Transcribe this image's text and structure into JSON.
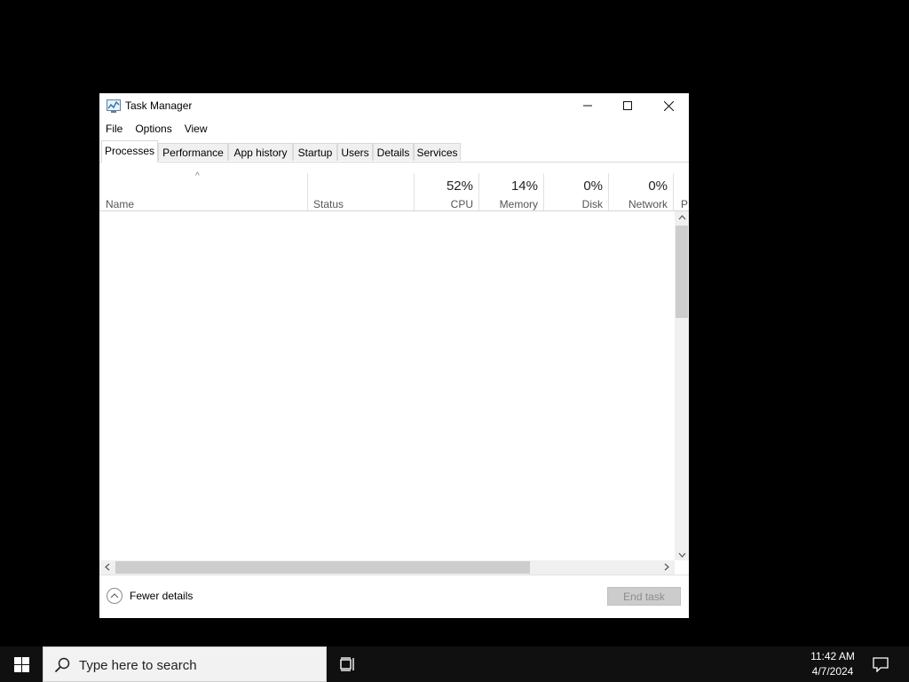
{
  "window": {
    "title": "Task Manager",
    "controls": {
      "minimize": "minimize-icon",
      "maximize": "maximize-icon",
      "close": "close-icon"
    }
  },
  "menu": [
    "File",
    "Options",
    "View"
  ],
  "tabs": [
    "Processes",
    "Performance",
    "App history",
    "Startup",
    "Users",
    "Details",
    "Services"
  ],
  "active_tab": "Processes",
  "columns": {
    "name": "Name",
    "status": "Status",
    "cpu": {
      "percent": "52%",
      "label": "CPU"
    },
    "memory": {
      "percent": "14%",
      "label": "Memory"
    },
    "disk": {
      "percent": "0%",
      "label": "Disk"
    },
    "network": {
      "percent": "0%",
      "label": "Network"
    },
    "power_partial": "P"
  },
  "sort_indicator": "^",
  "footer": {
    "fewer_details": "Fewer details",
    "end_task": "End task"
  },
  "taskbar": {
    "search_placeholder": "Type here to search",
    "time": "11:42 AM",
    "date": "4/7/2024"
  }
}
